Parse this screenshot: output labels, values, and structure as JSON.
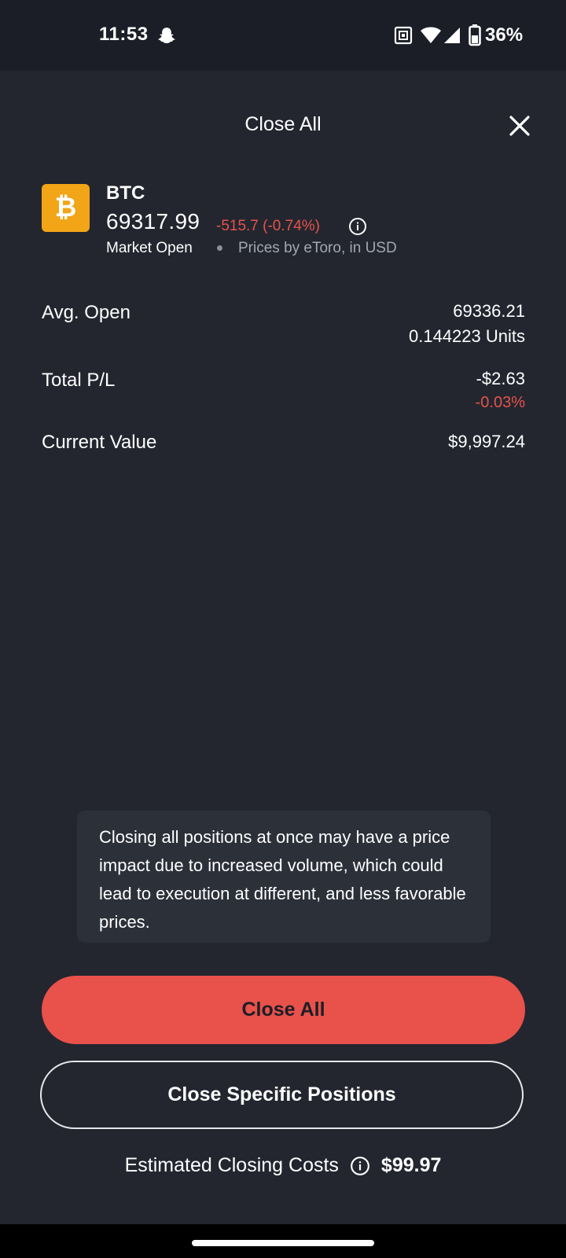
{
  "status_bar": {
    "time": "11:53",
    "battery_percent": "36%",
    "icons": [
      "snapchat-icon",
      "nfc-icon",
      "wifi-icon",
      "cell-signal-icon",
      "battery-icon"
    ]
  },
  "sheet": {
    "title": "Close All",
    "close_icon": "close-icon"
  },
  "asset": {
    "symbol": "BTC",
    "logo_glyph": "₿",
    "logo_color": "#F2A516",
    "price": "69317.99",
    "change": "-515.7 (-0.74%)",
    "market_status": "Market Open",
    "price_source": "Prices by eToro, in USD"
  },
  "details": {
    "avg_open": {
      "label": "Avg. Open",
      "value": "69336.21",
      "sub": "0.144223 Units"
    },
    "total_pl": {
      "label": "Total P/L",
      "value": "-$2.63",
      "sub": "-0.03%"
    },
    "current_value": {
      "label": "Current Value",
      "value": "$9,997.24"
    }
  },
  "warning": {
    "text": "Closing all positions at once may have a price impact due to increased volume, which could lead to execution at different, and less favorable prices."
  },
  "actions": {
    "close_all_label": "Close All",
    "close_specific_label": "Close Specific Positions"
  },
  "costs": {
    "label": "Estimated Closing Costs",
    "value": "$99.97"
  },
  "colors": {
    "background": "#23262F",
    "accent_red": "#E9514B",
    "negative": "#E5534B"
  }
}
